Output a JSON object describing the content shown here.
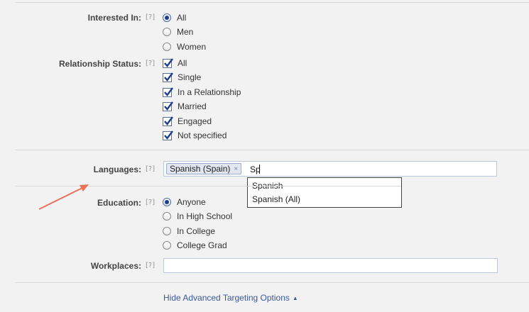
{
  "help_marker": "[?]",
  "interested_in": {
    "label": "Interested In:",
    "options": [
      {
        "label": "All",
        "selected": true
      },
      {
        "label": "Men",
        "selected": false
      },
      {
        "label": "Women",
        "selected": false
      }
    ]
  },
  "relationship_status": {
    "label": "Relationship Status:",
    "options": [
      {
        "label": "All",
        "checked": true
      },
      {
        "label": "Single",
        "checked": true
      },
      {
        "label": "In a Relationship",
        "checked": true
      },
      {
        "label": "Married",
        "checked": true
      },
      {
        "label": "Engaged",
        "checked": true
      },
      {
        "label": "Not specified",
        "checked": true
      }
    ]
  },
  "languages": {
    "label": "Languages:",
    "token": "Spanish (Spain)",
    "token_remove": "×",
    "input_value": "Sp",
    "suggestions": [
      "Spanish",
      "Spanish (All)"
    ]
  },
  "education": {
    "label": "Education:",
    "options": [
      {
        "label": "Anyone",
        "selected": true
      },
      {
        "label": "In High School",
        "selected": false
      },
      {
        "label": "In College",
        "selected": false
      },
      {
        "label": "College Grad",
        "selected": false
      }
    ]
  },
  "workplaces": {
    "label": "Workplaces:",
    "value": ""
  },
  "footer": {
    "hide_link": "Hide Advanced Targeting Options",
    "hide_icon": "caret-up-icon"
  },
  "colors": {
    "link": "#3b5998",
    "annotation_arrow": "#e8735a",
    "radio_selected": "#1c3e8c"
  }
}
